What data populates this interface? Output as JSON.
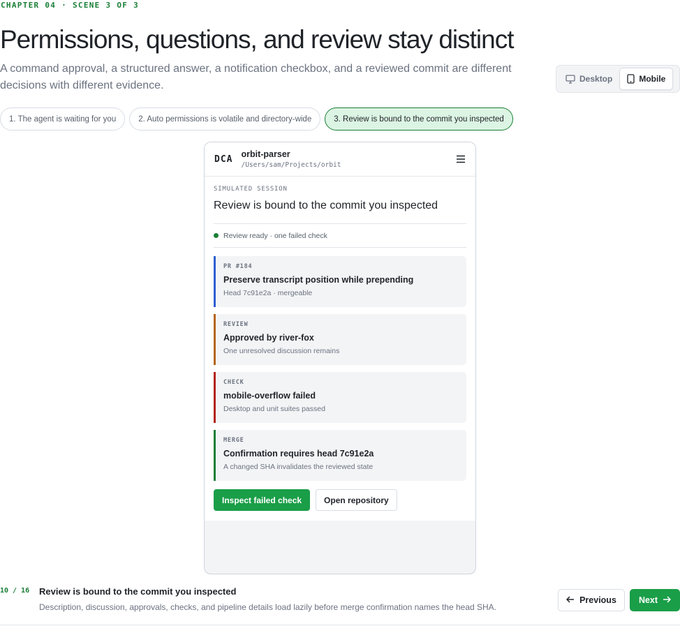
{
  "header": {
    "eyebrow": "CHAPTER 04 · SCENE 3 OF 3",
    "title": "Permissions, questions, and review stay distinct",
    "subtitle": "A command approval, a structured answer, a notification checkbox, and a reviewed commit are different decisions with different evidence."
  },
  "view_toggle": {
    "options": [
      {
        "label": "Desktop",
        "icon": "monitor-icon",
        "active": false
      },
      {
        "label": "Mobile",
        "icon": "phone-icon",
        "active": true
      }
    ]
  },
  "steps": [
    {
      "label": "1. The agent is waiting for you",
      "active": false
    },
    {
      "label": "2. Auto permissions is volatile and directory-wide",
      "active": false
    },
    {
      "label": "3. Review is bound to the commit you inspected",
      "active": true
    }
  ],
  "phone": {
    "logo": "DCA",
    "repo_name": "orbit-parser",
    "repo_path": "/Users/sam/Projects/orbit",
    "menu_icon": "hamburger-menu-icon",
    "session_label": "SIMULATED SESSION",
    "session_title": "Review is bound to the commit you inspected",
    "status_text": "Review ready · one failed check",
    "status_color": "#1a7f37",
    "cards": [
      {
        "kicker": "PR #184",
        "title": "Preserve transcript position while prepending",
        "sub": "Head 7c91e2a · mergeable",
        "accent": "#2f5fd0"
      },
      {
        "kicker": "REVIEW",
        "title": "Approved by river-fox",
        "sub": "One unresolved discussion remains",
        "accent": "#b5651d"
      },
      {
        "kicker": "CHECK",
        "title": "mobile-overflow failed",
        "sub": "Desktop and unit suites passed",
        "accent": "#b42318"
      },
      {
        "kicker": "MERGE",
        "title": "Confirmation requires head 7c91e2a",
        "sub": "A changed SHA invalidates the reviewed state",
        "accent": "#1a7f37"
      }
    ],
    "actions": {
      "primary": "Inspect failed check",
      "secondary": "Open repository"
    }
  },
  "footer": {
    "counter": "10 / 16",
    "title": "Review is bound to the commit you inspected",
    "description": "Description, discussion, approvals, checks, and pipeline details load lazily before merge confirmation names the head SHA.",
    "previous_label": "Previous",
    "next_label": "Next"
  },
  "colors": {
    "accent_green": "#1a9e48",
    "eyebrow_green": "#1a7f37"
  }
}
